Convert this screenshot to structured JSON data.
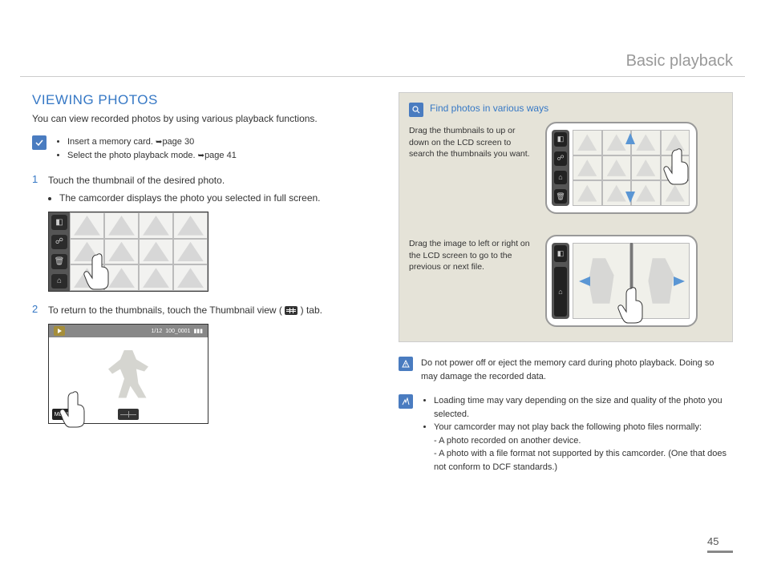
{
  "header": "Basic playback",
  "page_number": "45",
  "left": {
    "title": "VIEWING PHOTOS",
    "intro": "You can view recorded photos by using various playback functions.",
    "prereqs": {
      "item1_a": "Insert a memory card. ",
      "item1_b": "page 30",
      "item2_a": "Select the photo playback mode. ",
      "item2_b": "page 41"
    },
    "step1": {
      "num": "1",
      "text": "Touch the thumbnail of the desired photo.",
      "sub": "The camcorder displays the photo you selected in full screen."
    },
    "step2": {
      "num": "2",
      "text_a": "To return to the thumbnails, touch the Thumbnail view (",
      "text_b": ") tab."
    },
    "fullfig": {
      "counter": "1/12",
      "file": "100_0001",
      "menu": "MENU"
    }
  },
  "right": {
    "panel": {
      "title": "Find photos in various ways",
      "tip1": "Drag the thumbnails to up or down on the LCD screen to search the thumbnails you want.",
      "tip2": "Drag the image to left or right on the LCD screen to go to the previous or next file."
    },
    "warn": "Do not power off or eject the memory card during photo playback. Doing so may damage the recorded data.",
    "notes": {
      "n1": "Loading time may vary depending on the size and quality of the photo you selected.",
      "n2": "Your camcorder may not play back the following photo files normally:",
      "n2a": "- A photo recorded on another device.",
      "n2b": "- A photo with a file format not supported by this camcorder. (One that does not conform to DCF standards.)"
    }
  }
}
